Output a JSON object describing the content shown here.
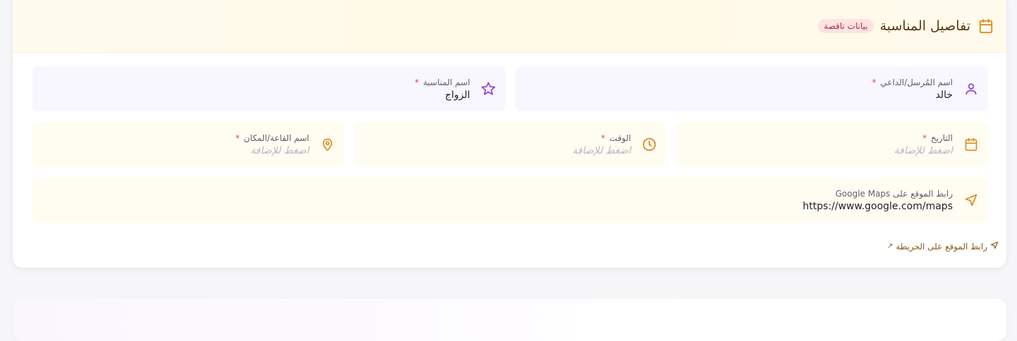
{
  "section": {
    "title": "تفاصيل المناسبة",
    "badge": "بيانات ناقصة"
  },
  "fields": {
    "sender": {
      "label": "اسم المُرسل/الداعي",
      "required": "*",
      "value": "خالد"
    },
    "occasion": {
      "label": "اسم المناسبة",
      "required": "*",
      "value": "الزواج"
    },
    "date": {
      "label": "التاريخ",
      "required": "*",
      "placeholder": "اضغط للإضافة"
    },
    "time": {
      "label": "الوقت",
      "required": "*",
      "placeholder": "اضغط للإضافة"
    },
    "venue": {
      "label": "اسم القاعة/المكان",
      "required": "*",
      "placeholder": "اضغط للإضافة"
    },
    "maps": {
      "label": "رابط الموقع على Google Maps",
      "value": "https://www.google.com/maps"
    }
  },
  "map_link": {
    "label": "رابط الموقع على الخريطة",
    "arrow": "↗"
  },
  "colors": {
    "accent": "#d98e1c",
    "purple": "#8b3fd9",
    "required": "#e04b5a",
    "badge_bg": "#fde3e3",
    "badge_text": "#b3303a"
  }
}
